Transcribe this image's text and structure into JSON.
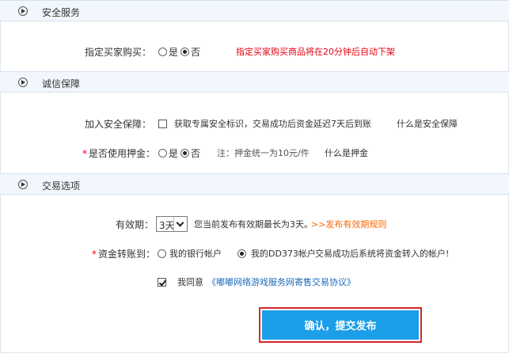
{
  "sections": {
    "security": {
      "title": "安全服务"
    },
    "integrity": {
      "title": "诚信保障"
    },
    "trade": {
      "title": "交易选项"
    }
  },
  "buyer": {
    "label": "指定买家购买：",
    "yes": "是",
    "no": "否",
    "notice": "指定买家购买商品将在20分钟后自动下架"
  },
  "guarantee": {
    "label": "加入安全保障：",
    "checkbox_text": "获取专属安全标识，交易成功后资金延迟7天后到账",
    "link": "什么是安全保障"
  },
  "deposit": {
    "star": "*",
    "label": "是否使用押金：",
    "yes": "是",
    "no": "否",
    "note": "注：押金统一为10元/件",
    "link": "什么是押金"
  },
  "validity": {
    "label": "有效期：",
    "selected": "3天",
    "note": "您当前发布有效期最长为3天。",
    "rule_link": ">>发布有效期规则"
  },
  "transfer": {
    "star": "*",
    "label": "资金转账到：",
    "option_bank": "我的银行帐户",
    "option_dd": "我的DD373帐户",
    "note": "交易成功后系统将资金转入的帐户!"
  },
  "agree": {
    "prefix": "我同意",
    "link": "《嘟嘟网络游戏服务网寄售交易协议》"
  },
  "submit": {
    "label": "确认，提交发布"
  }
}
